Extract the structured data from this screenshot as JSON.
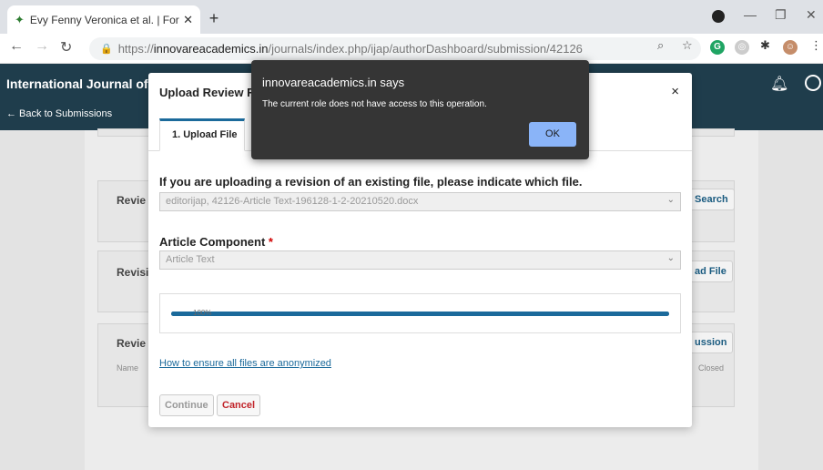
{
  "browser": {
    "tab_title": "Evy Fenny Veronica et al. | Formu",
    "url_scheme": "https://",
    "url_host": "innovareacademics.in",
    "url_path": "/journals/index.php/ijap/authorDashboard/submission/42126"
  },
  "app": {
    "title": "International Journal of",
    "back_link": "← Back to Submissions"
  },
  "cards": [
    {
      "title": "Revie",
      "button": "Search"
    },
    {
      "title": "Revisi",
      "button": "ad File"
    },
    {
      "title": "Revie",
      "button": "ussion",
      "col_left": "Name",
      "col_right": "Closed"
    }
  ],
  "modal": {
    "title": "Upload Review Fi",
    "close": "×",
    "tab_label": "1. Upload File",
    "revision_label": "If you are uploading a revision of an existing file, please indicate which file.",
    "revision_value": "editorijap, 42126-Article Text-196128-1-2-20210520.docx",
    "component_label": "Article Component",
    "component_required": "*",
    "component_value": "Article Text",
    "progress_percent": 100,
    "progress_text": "100%",
    "help_link": "How to ensure all files are anonymized",
    "continue_label": "Continue",
    "cancel_label": "Cancel"
  },
  "alert": {
    "title": "innovareacademics.in says",
    "message": "The current role does not have access to this operation.",
    "ok_label": "OK"
  },
  "colors": {
    "header_bg": "#1f3d4c",
    "accent": "#1b6a9b",
    "cancel": "#c1242a",
    "alert_bg": "#353535",
    "ok_btn": "#8ab4f8"
  }
}
